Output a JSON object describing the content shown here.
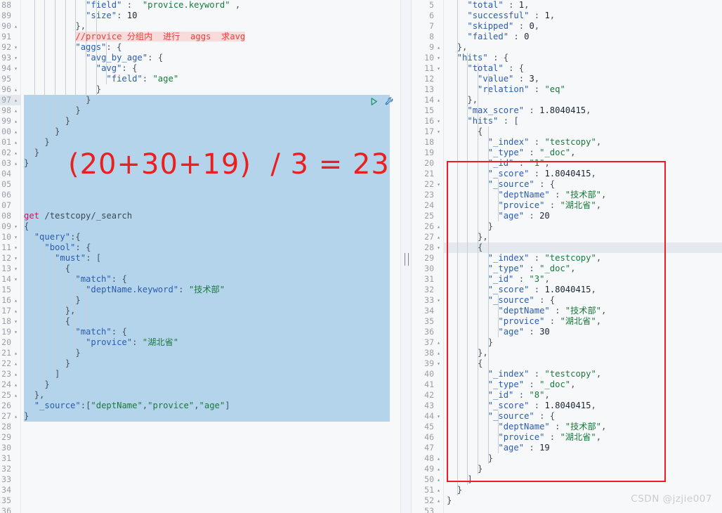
{
  "editor": {
    "left": {
      "name": "request-editor",
      "first_line_number": 88,
      "selection_start_line": 97,
      "selection_end_line": 117,
      "current_line": 97,
      "run_icons": [
        {
          "name": "run-request-icon",
          "glyph": "play-triangle"
        },
        {
          "name": "auto-indent-wrench-icon",
          "glyph": "wrench"
        }
      ],
      "lines": [
        {
          "n": 88,
          "fold": "",
          "text": "            \"field\" :  \"provice.keyword\" ,"
        },
        {
          "n": 89,
          "fold": "",
          "text": "            \"size\": 10"
        },
        {
          "n": 90,
          "fold": "^",
          "text": "          },"
        },
        {
          "n": 91,
          "fold": "",
          "text": "          //provice 分组内  进行  aggs  求avg"
        },
        {
          "n": 92,
          "fold": "v",
          "text": "          \"aggs\": {"
        },
        {
          "n": 93,
          "fold": "v",
          "text": "            \"avg_by_age\": {"
        },
        {
          "n": 94,
          "fold": "v",
          "text": "              \"avg\": {"
        },
        {
          "n": 95,
          "fold": "",
          "text": "                \"field\": \"age\""
        },
        {
          "n": 96,
          "fold": "^",
          "text": "              }"
        },
        {
          "n": 97,
          "fold": "^",
          "text": "            }"
        },
        {
          "n": 98,
          "fold": "^",
          "text": "          }"
        },
        {
          "n": 99,
          "fold": "^",
          "text": "        }"
        },
        {
          "n": 100,
          "fold": "^",
          "text": "      }"
        },
        {
          "n": 101,
          "fold": "^",
          "text": "    }"
        },
        {
          "n": 102,
          "fold": "^",
          "text": "  }"
        },
        {
          "n": 103,
          "fold": "^",
          "text": "}"
        },
        {
          "n": 104,
          "fold": "",
          "text": ""
        },
        {
          "n": 105,
          "fold": "",
          "text": ""
        },
        {
          "n": 106,
          "fold": "",
          "text": ""
        },
        {
          "n": 107,
          "fold": "",
          "text": ""
        },
        {
          "n": 108,
          "fold": "",
          "text": "get /testcopy/_search"
        },
        {
          "n": 109,
          "fold": "v",
          "text": "{"
        },
        {
          "n": 110,
          "fold": "v",
          "text": "  \"query\":{"
        },
        {
          "n": 111,
          "fold": "v",
          "text": "    \"bool\": {"
        },
        {
          "n": 112,
          "fold": "v",
          "text": "      \"must\": ["
        },
        {
          "n": 113,
          "fold": "v",
          "text": "        {"
        },
        {
          "n": 114,
          "fold": "v",
          "text": "          \"match\": {"
        },
        {
          "n": 115,
          "fold": "",
          "text": "            \"deptName.keyword\": \"技术部\""
        },
        {
          "n": 116,
          "fold": "^",
          "text": "          }"
        },
        {
          "n": 117,
          "fold": "^",
          "text": "        },"
        },
        {
          "n": 118,
          "fold": "v",
          "text": "        {"
        },
        {
          "n": 119,
          "fold": "v",
          "text": "          \"match\": {"
        },
        {
          "n": 120,
          "fold": "",
          "text": "            \"provice\": \"湖北省\""
        },
        {
          "n": 121,
          "fold": "^",
          "text": "          }"
        },
        {
          "n": 122,
          "fold": "^",
          "text": "        }"
        },
        {
          "n": 123,
          "fold": "^",
          "text": "      ]"
        },
        {
          "n": 124,
          "fold": "^",
          "text": "    }"
        },
        {
          "n": 125,
          "fold": "^",
          "text": "  },"
        },
        {
          "n": 126,
          "fold": "",
          "text": "  \"_source\":[\"deptName\",\"provice\",\"age\"]"
        },
        {
          "n": 127,
          "fold": "^",
          "text": "}"
        },
        {
          "n": 128,
          "fold": "",
          "text": ""
        },
        {
          "n": 129,
          "fold": "",
          "text": ""
        },
        {
          "n": 130,
          "fold": "",
          "text": ""
        },
        {
          "n": 131,
          "fold": "",
          "text": ""
        },
        {
          "n": 132,
          "fold": "",
          "text": ""
        },
        {
          "n": 133,
          "fold": "",
          "text": ""
        },
        {
          "n": 134,
          "fold": "",
          "text": ""
        },
        {
          "n": 135,
          "fold": "",
          "text": ""
        },
        {
          "n": 136,
          "fold": "",
          "text": ""
        }
      ]
    },
    "right": {
      "name": "response-viewer",
      "current_line": 28,
      "lines": [
        {
          "n": 5,
          "fold": "",
          "text": "    \"total\" : 1,"
        },
        {
          "n": 6,
          "fold": "",
          "text": "    \"successful\" : 1,"
        },
        {
          "n": 7,
          "fold": "",
          "text": "    \"skipped\" : 0,"
        },
        {
          "n": 8,
          "fold": "",
          "text": "    \"failed\" : 0"
        },
        {
          "n": 9,
          "fold": "^",
          "text": "  },"
        },
        {
          "n": 10,
          "fold": "v",
          "text": "  \"hits\" : {"
        },
        {
          "n": 11,
          "fold": "v",
          "text": "    \"total\" : {"
        },
        {
          "n": 12,
          "fold": "",
          "text": "      \"value\" : 3,"
        },
        {
          "n": 13,
          "fold": "",
          "text": "      \"relation\" : \"eq\""
        },
        {
          "n": 14,
          "fold": "^",
          "text": "    },"
        },
        {
          "n": 15,
          "fold": "",
          "text": "    \"max_score\" : 1.8040415,"
        },
        {
          "n": 16,
          "fold": "v",
          "text": "    \"hits\" : ["
        },
        {
          "n": 17,
          "fold": "v",
          "text": "      {"
        },
        {
          "n": 18,
          "fold": "",
          "text": "        \"_index\" : \"testcopy\","
        },
        {
          "n": 19,
          "fold": "",
          "text": "        \"_type\" : \"_doc\","
        },
        {
          "n": 20,
          "fold": "",
          "text": "        \"_id\" : \"1\","
        },
        {
          "n": 21,
          "fold": "",
          "text": "        \"_score\" : 1.8040415,"
        },
        {
          "n": 22,
          "fold": "v",
          "text": "        \"_source\" : {"
        },
        {
          "n": 23,
          "fold": "",
          "text": "          \"deptName\" : \"技术部\","
        },
        {
          "n": 24,
          "fold": "",
          "text": "          \"provice\" : \"湖北省\","
        },
        {
          "n": 25,
          "fold": "",
          "text": "          \"age\" : 20"
        },
        {
          "n": 26,
          "fold": "^",
          "text": "        }"
        },
        {
          "n": 27,
          "fold": "^",
          "text": "      },"
        },
        {
          "n": 28,
          "fold": "v",
          "text": "      {"
        },
        {
          "n": 29,
          "fold": "",
          "text": "        \"_index\" : \"testcopy\","
        },
        {
          "n": 30,
          "fold": "",
          "text": "        \"_type\" : \"_doc\","
        },
        {
          "n": 31,
          "fold": "",
          "text": "        \"_id\" : \"3\","
        },
        {
          "n": 32,
          "fold": "",
          "text": "        \"_score\" : 1.8040415,"
        },
        {
          "n": 33,
          "fold": "v",
          "text": "        \"_source\" : {"
        },
        {
          "n": 34,
          "fold": "",
          "text": "          \"deptName\" : \"技术部\","
        },
        {
          "n": 35,
          "fold": "",
          "text": "          \"provice\" : \"湖北省\","
        },
        {
          "n": 36,
          "fold": "",
          "text": "          \"age\" : 30"
        },
        {
          "n": 37,
          "fold": "^",
          "text": "        }"
        },
        {
          "n": 38,
          "fold": "^",
          "text": "      },"
        },
        {
          "n": 39,
          "fold": "v",
          "text": "      {"
        },
        {
          "n": 40,
          "fold": "",
          "text": "        \"_index\" : \"testcopy\","
        },
        {
          "n": 41,
          "fold": "",
          "text": "        \"_type\" : \"_doc\","
        },
        {
          "n": 42,
          "fold": "",
          "text": "        \"_id\" : \"8\","
        },
        {
          "n": 43,
          "fold": "",
          "text": "        \"_score\" : 1.8040415,"
        },
        {
          "n": 44,
          "fold": "v",
          "text": "        \"_source\" : {"
        },
        {
          "n": 45,
          "fold": "",
          "text": "          \"deptName\" : \"技术部\","
        },
        {
          "n": 46,
          "fold": "",
          "text": "          \"provice\" : \"湖北省\","
        },
        {
          "n": 47,
          "fold": "",
          "text": "          \"age\" : 19"
        },
        {
          "n": 48,
          "fold": "^",
          "text": "        }"
        },
        {
          "n": 49,
          "fold": "^",
          "text": "      }"
        },
        {
          "n": 50,
          "fold": "^",
          "text": "    ]"
        },
        {
          "n": 51,
          "fold": "^",
          "text": "  }"
        },
        {
          "n": 52,
          "fold": "^",
          "text": "}"
        },
        {
          "n": 53,
          "fold": "",
          "text": ""
        }
      ]
    }
  },
  "annotations": {
    "formula": "(20+30+19)  / 3 = 23",
    "formula_color": "#e8201f",
    "highlight_box": {
      "name": "hits-highlight-box",
      "color": "#ee1c25"
    },
    "comment_highlight_color": "#fadbdb"
  },
  "watermark": {
    "text": "CSDN @jzjie007"
  }
}
